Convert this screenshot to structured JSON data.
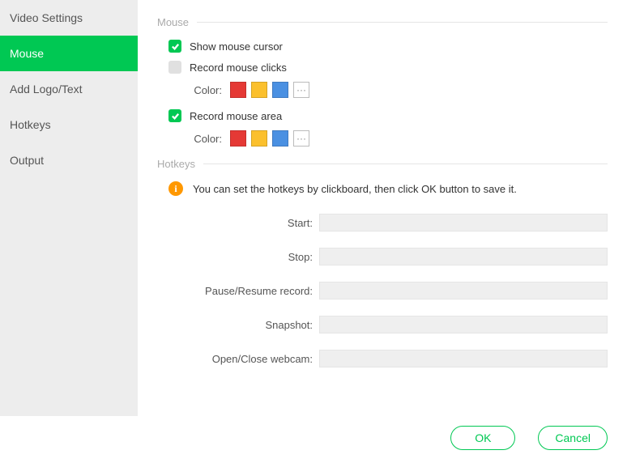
{
  "sidebar": {
    "items": [
      {
        "label": "Video Settings"
      },
      {
        "label": "Mouse"
      },
      {
        "label": "Add Logo/Text"
      },
      {
        "label": "Hotkeys"
      },
      {
        "label": "Output"
      }
    ],
    "activeIndex": 1
  },
  "sections": {
    "mouse": {
      "title": "Mouse"
    },
    "hotkeys": {
      "title": "Hotkeys"
    }
  },
  "mouse": {
    "showCursor": {
      "label": "Show mouse cursor",
      "checked": true
    },
    "recordClicks": {
      "label": "Record mouse clicks",
      "checked": false,
      "colorLabel": "Color:"
    },
    "recordArea": {
      "label": "Record mouse area",
      "checked": true,
      "colorLabel": "Color:"
    }
  },
  "colors": {
    "red": "#e53935",
    "yellow": "#fbc02d",
    "blue": "#4a90e2",
    "moreLabel": "···"
  },
  "hotkeys": {
    "info": "You can set the hotkeys by clickboard, then click OK button to save it.",
    "fields": {
      "start": {
        "label": "Start:",
        "value": ""
      },
      "stop": {
        "label": "Stop:",
        "value": ""
      },
      "pause": {
        "label": "Pause/Resume record:",
        "value": ""
      },
      "snapshot": {
        "label": "Snapshot:",
        "value": ""
      },
      "webcam": {
        "label": "Open/Close webcam:",
        "value": ""
      }
    }
  },
  "footer": {
    "ok": "OK",
    "cancel": "Cancel"
  }
}
